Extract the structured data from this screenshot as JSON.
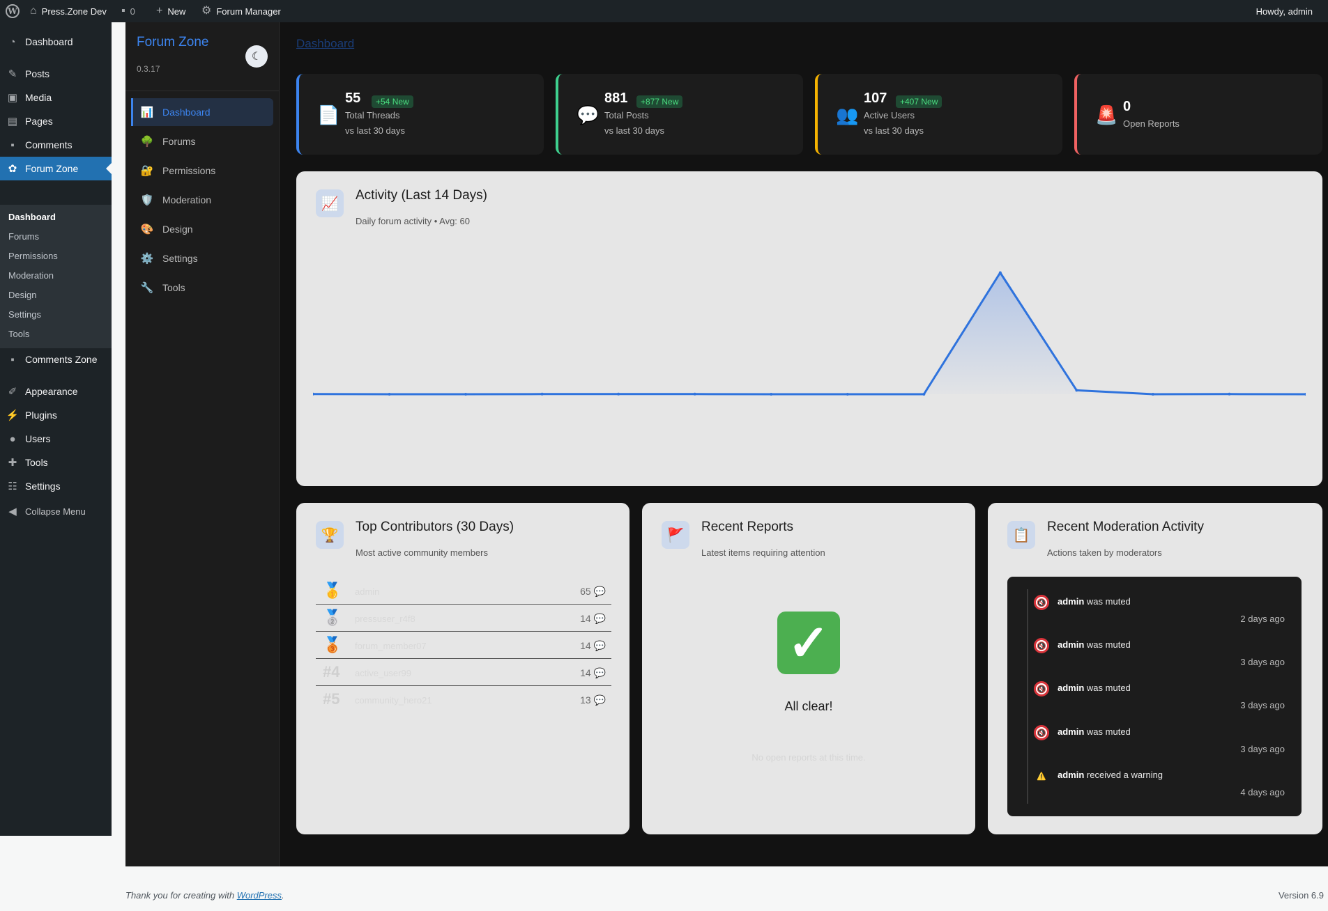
{
  "admin_bar": {
    "site_name": "Press.Zone Dev",
    "comments_count": "0",
    "new_label": "New",
    "forum_manager_label": "Forum Manager",
    "howdy": "Howdy, admin"
  },
  "wp_menu": {
    "items": [
      {
        "label": "Dashboard",
        "icon": "dashboard-icon"
      },
      {
        "label": "Posts",
        "icon": "pin-icon"
      },
      {
        "label": "Media",
        "icon": "media-icon"
      },
      {
        "label": "Pages",
        "icon": "pages-icon"
      },
      {
        "label": "Comments",
        "icon": "comment-icon"
      },
      {
        "label": "Forum Zone",
        "icon": "groups-icon"
      },
      {
        "label": "Comments Zone",
        "icon": "comment-icon"
      },
      {
        "label": "Appearance",
        "icon": "brush-icon"
      },
      {
        "label": "Plugins",
        "icon": "plug-icon"
      },
      {
        "label": "Users",
        "icon": "user-icon"
      },
      {
        "label": "Tools",
        "icon": "wrench-icon"
      },
      {
        "label": "Settings",
        "icon": "sliders-icon"
      },
      {
        "label": "Collapse Menu",
        "icon": "collapse-icon"
      }
    ],
    "submenu": [
      "Dashboard",
      "Forums",
      "Permissions",
      "Moderation",
      "Design",
      "Settings",
      "Tools"
    ]
  },
  "plugin": {
    "brand": "Forum Zone",
    "version": "0.3.17",
    "nav": [
      {
        "label": "Dashboard",
        "icon": "📊"
      },
      {
        "label": "Forums",
        "icon": "🌳"
      },
      {
        "label": "Permissions",
        "icon": "🔐"
      },
      {
        "label": "Moderation",
        "icon": "🛡️"
      },
      {
        "label": "Design",
        "icon": "🎨"
      },
      {
        "label": "Settings",
        "icon": "⚙️"
      },
      {
        "label": "Tools",
        "icon": "🔧"
      }
    ]
  },
  "page_title": "Dashboard",
  "stats": [
    {
      "value": "55",
      "badge": "+54 New",
      "label": "Total Threads",
      "sub": "vs last 30 days",
      "icon": "📄",
      "color": "#3c84ef"
    },
    {
      "value": "881",
      "badge": "+877 New",
      "label": "Total Posts",
      "sub": "vs last 30 days",
      "icon": "💬",
      "color": "#3ecf8e"
    },
    {
      "value": "107",
      "badge": "+407 New",
      "label": "Active Users",
      "sub": "vs last 30 days",
      "icon": "👥",
      "color": "#f5b301"
    },
    {
      "value": "0",
      "badge": "",
      "label": "Open Reports",
      "sub": "",
      "icon": "🚨",
      "color": "#f06262"
    }
  ],
  "activity": {
    "title": "Activity (Last 14 Days)",
    "subtitle": "Daily forum activity • Avg: 60",
    "icon": "📈"
  },
  "chart_data": {
    "type": "area",
    "title": "Activity (Last 14 Days)",
    "x": [
      1,
      2,
      3,
      4,
      5,
      6,
      7,
      8,
      9,
      10,
      11,
      12,
      13,
      14
    ],
    "values": [
      1,
      0,
      0,
      1,
      1,
      1,
      0,
      0,
      0,
      806,
      26,
      0,
      1,
      0
    ],
    "ylim": [
      0,
      850
    ],
    "grid": false,
    "color": "#2f73dd"
  },
  "contributors": {
    "title": "Top Contributors (30 Days)",
    "subtitle": "Most active community members",
    "icon": "🏆",
    "rows": [
      {
        "rank": "🥇",
        "name": "admin",
        "count": "65"
      },
      {
        "rank": "🥈",
        "name": "pressuser_r4f8",
        "count": "14"
      },
      {
        "rank": "🥉",
        "name": "forum_member07",
        "count": "14"
      },
      {
        "rank": "#4",
        "name": "active_user99",
        "count": "14"
      },
      {
        "rank": "#5",
        "name": "community_hero21",
        "count": "13"
      }
    ]
  },
  "reports": {
    "title": "Recent Reports",
    "subtitle": "Latest items requiring attention",
    "icon": "🚩",
    "empty_title": "All clear!",
    "empty_sub": "No open reports at this time."
  },
  "moderation": {
    "title": "Recent Moderation Activity",
    "subtitle": "Actions taken by moderators",
    "icon": "📋",
    "items": [
      {
        "user": "admin",
        "action": "was muted",
        "time": "2 days ago",
        "type": "muted"
      },
      {
        "user": "admin",
        "action": "was muted",
        "time": "3 days ago",
        "type": "muted"
      },
      {
        "user": "admin",
        "action": "was muted",
        "time": "3 days ago",
        "type": "muted"
      },
      {
        "user": "admin",
        "action": "was muted",
        "time": "3 days ago",
        "type": "muted"
      },
      {
        "user": "admin",
        "action": "received a warning",
        "time": "4 days ago",
        "type": "warning"
      }
    ]
  },
  "footer": {
    "thanks_prefix": "Thank you for creating with",
    "link": "WordPress",
    "thanks_suffix": ".",
    "version": "Version 6.9"
  }
}
